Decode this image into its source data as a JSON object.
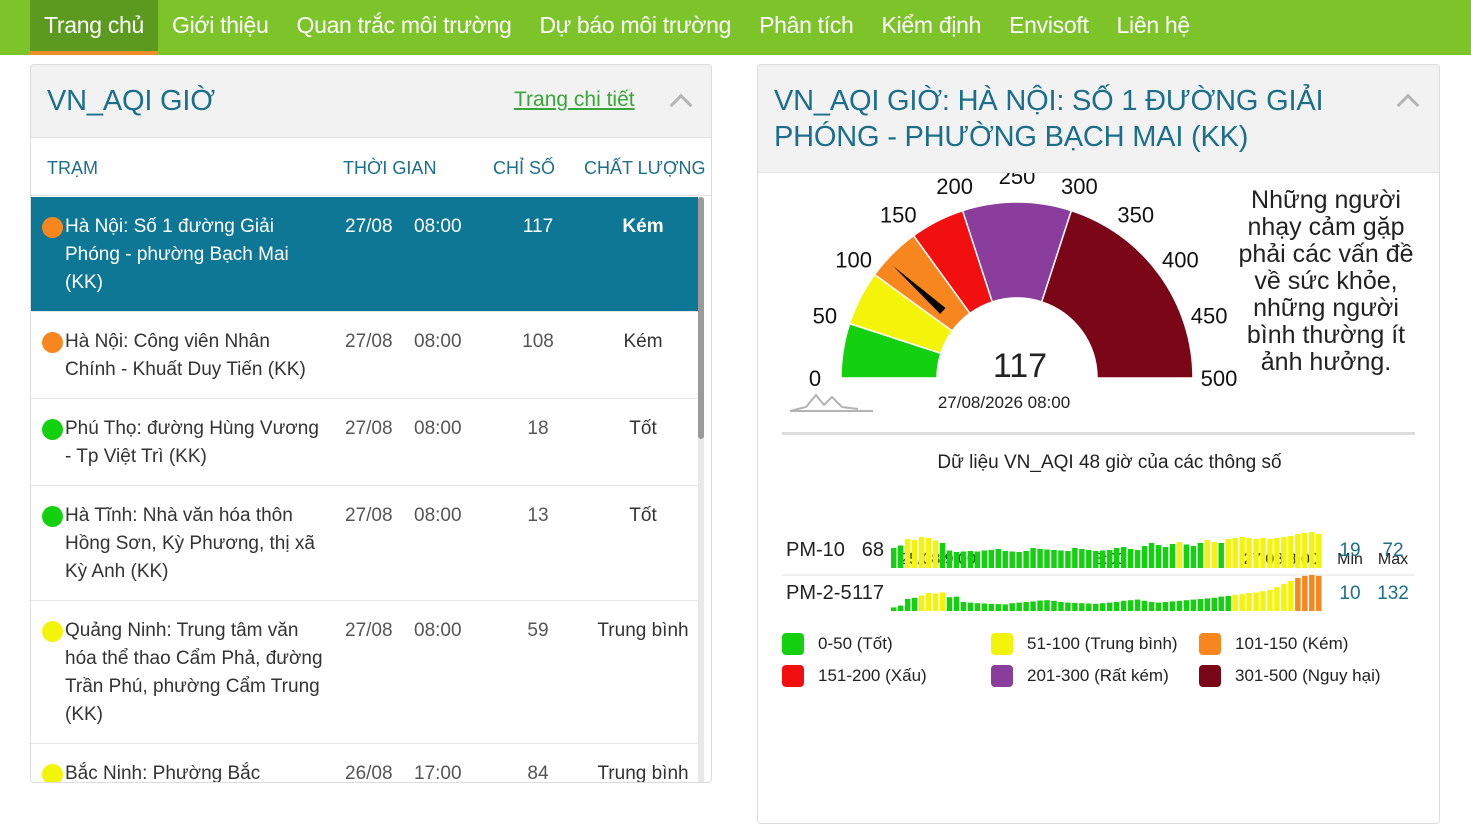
{
  "nav": {
    "items": [
      "Trang chủ",
      "Giới thiệu",
      "Quan trắc môi trường",
      "Dự báo môi trường",
      "Phân tích",
      "Kiểm định",
      "Envisoft",
      "Liên hệ"
    ]
  },
  "left_panel": {
    "title": "VN_AQI GIỜ",
    "detail_link": "Trang chi tiết",
    "headers": {
      "station": "TRẠM",
      "time": "THỜI GIAN",
      "index": "CHỈ SỐ",
      "quality": "CHẤT LƯỢNG"
    },
    "rows": [
      {
        "station": "Hà Nội: Số 1 đường Giải Phóng - phường Bạch Mai (KK)",
        "date": "27/08",
        "time": "08:00",
        "index": "117",
        "quality": "Kém",
        "color": "#f7861e",
        "selected": true
      },
      {
        "station": "Hà Nội: Công viên Nhân Chính - Khuất Duy Tiến (KK)",
        "date": "27/08",
        "time": "08:00",
        "index": "108",
        "quality": "Kém",
        "color": "#f7861e",
        "selected": false
      },
      {
        "station": "Phú Thọ: đường Hùng Vương - Tp Việt Trì (KK)",
        "date": "27/08",
        "time": "08:00",
        "index": "18",
        "quality": "Tốt",
        "color": "#14d10f",
        "selected": false
      },
      {
        "station": "Hà Tĩnh: Nhà văn hóa thôn Hồng Sơn, Kỳ Phương, thị xã Kỳ Anh (KK)",
        "date": "27/08",
        "time": "08:00",
        "index": "13",
        "quality": "Tốt",
        "color": "#14d10f",
        "selected": false
      },
      {
        "station": "Quảng Ninh: Trung tâm văn hóa thể thao Cẩm Phả, đường Trần Phú, phường Cẩm Trung (KK)",
        "date": "27/08",
        "time": "08:00",
        "index": "59",
        "quality": "Trung bình",
        "color": "#f4f40a",
        "selected": false
      },
      {
        "station": "Bắc Ninh: Phường Bắc",
        "date": "26/08",
        "time": "17:00",
        "index": "84",
        "quality": "Trung bình",
        "color": "#f4f40a",
        "selected": false
      }
    ]
  },
  "right_panel": {
    "title": "VN_AQI GIỜ: HÀ NỘI: SỐ 1 ĐƯỜNG GIẢI PHÓNG - PHƯỜNG BẠCH MAI (KK)",
    "gauge": {
      "value": "117",
      "timestamp": "27/08/2026 08:00",
      "ticks": [
        "0",
        "50",
        "100",
        "150",
        "200",
        "250",
        "300",
        "350",
        "400",
        "450",
        "500"
      ],
      "advice": "Những người nhạy cảm gặp phải các vấn đề về sức khỏe, những người bình thường ít ảnh hưởng."
    },
    "history": {
      "title": "Dữ liệu VN_AQI 48 giờ của các thông số",
      "time_labels": [
        "25/08 9:00",
        "8:00",
        "27/08 8:00"
      ],
      "min_label": "Min",
      "max_label": "Max",
      "params": [
        {
          "name": "PM-10",
          "current": "68",
          "min": "19",
          "max": "72"
        },
        {
          "name": "PM-2-5",
          "current": "117",
          "min": "10",
          "max": "132"
        }
      ]
    },
    "legend": [
      {
        "label": "0-50 (Tốt)",
        "color": "#14d10f"
      },
      {
        "label": "51-100 (Trung bình)",
        "color": "#f4f40a"
      },
      {
        "label": "101-150 (Kém)",
        "color": "#f7861e"
      },
      {
        "label": "151-200 (Xấu)",
        "color": "#f20f0f"
      },
      {
        "label": "201-300 (Rất kém)",
        "color": "#8a3d9c"
      },
      {
        "label": "301-500 (Nguy hại)",
        "color": "#7b0618"
      }
    ]
  },
  "chart_data": [
    {
      "type": "bar",
      "title": "Dữ liệu VN_AQI 48 giờ của các thông số",
      "series": [
        {
          "name": "PM-10",
          "values": [
            40,
            45,
            58,
            56,
            62,
            60,
            55,
            50,
            35,
            32,
            33,
            34,
            33,
            35,
            36,
            38,
            34,
            33,
            32,
            34,
            40,
            38,
            37,
            36,
            35,
            34,
            40,
            38,
            36,
            34,
            35,
            36,
            40,
            42,
            38,
            36,
            44,
            50,
            46,
            42,
            48,
            52,
            47,
            44,
            50,
            56,
            52,
            50,
            58,
            60,
            62,
            60,
            58,
            60,
            58,
            60,
            62,
            64,
            68,
            70,
            72,
            68
          ]
        },
        {
          "name": "PM-2-5",
          "values": [
            12,
            18,
            40,
            44,
            52,
            60,
            58,
            62,
            46,
            48,
            30,
            28,
            26,
            25,
            24,
            23,
            22,
            26,
            28,
            30,
            32,
            35,
            36,
            34,
            30,
            28,
            27,
            26,
            25,
            24,
            26,
            28,
            30,
            34,
            36,
            38,
            34,
            30,
            28,
            30,
            32,
            34,
            36,
            38,
            40,
            42,
            44,
            48,
            50,
            54,
            56,
            60,
            62,
            66,
            70,
            80,
            90,
            100,
            110,
            117,
            120,
            117
          ]
        }
      ]
    }
  ]
}
